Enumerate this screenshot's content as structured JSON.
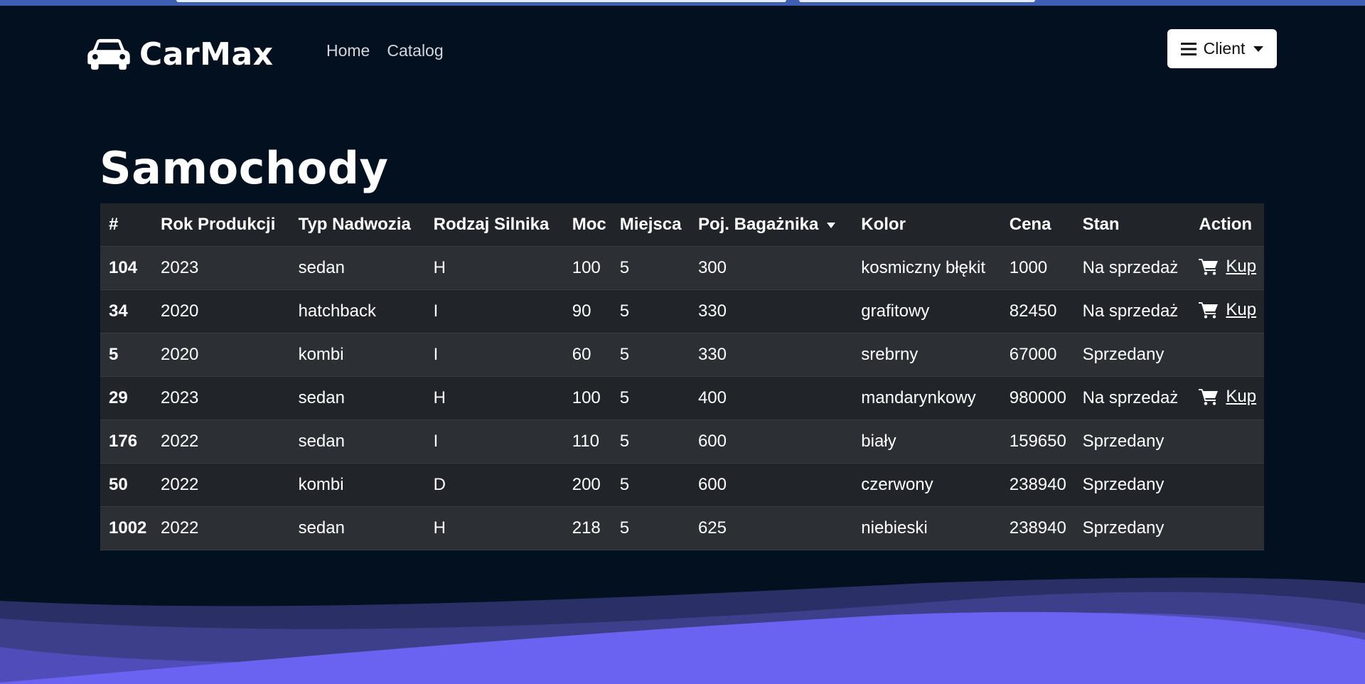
{
  "app": {
    "brand": "CarMax",
    "nav": [
      "Home",
      "Catalog"
    ],
    "user_menu_label": "Client"
  },
  "page": {
    "title": "Samochody"
  },
  "table": {
    "columns": [
      "#",
      "Rok Produkcji",
      "Typ Nadwozia",
      "Rodzaj Silnika",
      "Moc",
      "Miejsca",
      "Poj. Bagażnika",
      "Kolor",
      "Cena",
      "Stan",
      "Action"
    ],
    "sorted_column": "Poj. Bagażnika",
    "sort_direction": "descending-indicator",
    "action_label": "Kup",
    "rows": [
      {
        "id": "104",
        "year": "2023",
        "body": "sedan",
        "engine": "H",
        "power": "100",
        "seats": "5",
        "trunk": "300",
        "color": "kosmiczny błękit",
        "price": "1000",
        "status": "Na sprzedaż",
        "buyable": true
      },
      {
        "id": "34",
        "year": "2020",
        "body": "hatchback",
        "engine": "I",
        "power": "90",
        "seats": "5",
        "trunk": "330",
        "color": "grafitowy",
        "price": "82450",
        "status": "Na sprzedaż",
        "buyable": true
      },
      {
        "id": "5",
        "year": "2020",
        "body": "kombi",
        "engine": "I",
        "power": "60",
        "seats": "5",
        "trunk": "330",
        "color": "srebrny",
        "price": "67000",
        "status": "Sprzedany",
        "buyable": false
      },
      {
        "id": "29",
        "year": "2023",
        "body": "sedan",
        "engine": "H",
        "power": "100",
        "seats": "5",
        "trunk": "400",
        "color": "mandarynkowy",
        "price": "980000",
        "status": "Na sprzedaż",
        "buyable": true
      },
      {
        "id": "176",
        "year": "2022",
        "body": "sedan",
        "engine": "I",
        "power": "110",
        "seats": "5",
        "trunk": "600",
        "color": "biały",
        "price": "159650",
        "status": "Sprzedany",
        "buyable": false
      },
      {
        "id": "50",
        "year": "2022",
        "body": "kombi",
        "engine": "D",
        "power": "200",
        "seats": "5",
        "trunk": "600",
        "color": "czerwony",
        "price": "238940",
        "status": "Sprzedany",
        "buyable": false
      },
      {
        "id": "1002",
        "year": "2022",
        "body": "sedan",
        "engine": "H",
        "power": "218",
        "seats": "5",
        "trunk": "625",
        "color": "niebieski",
        "price": "238940",
        "status": "Sprzedany",
        "buyable": false
      }
    ]
  },
  "colors": {
    "background": "#03101f",
    "table_header": "#212529",
    "status_for_sale": "#157a2a",
    "status_sold": "#e3161b",
    "wave_accent": "#6a63f2"
  },
  "icons": {
    "brand": "car-icon",
    "menu": "hamburger-icon",
    "buy": "shopping-cart-icon"
  }
}
